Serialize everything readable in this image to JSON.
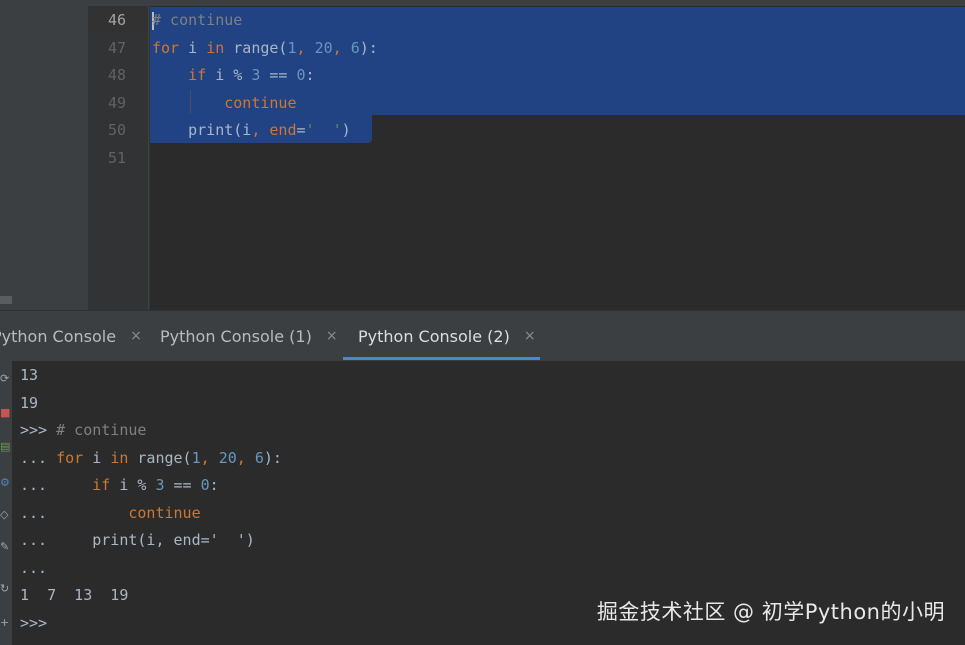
{
  "editor": {
    "line_numbers": [
      "46",
      "47",
      "48",
      "49",
      "50",
      "51"
    ],
    "lines": [
      {
        "parts": [
          {
            "t": "# continue",
            "c": "cm"
          }
        ]
      },
      {
        "parts": [
          {
            "t": "for",
            "c": "kw"
          },
          {
            "t": " i ",
            "c": ""
          },
          {
            "t": "in",
            "c": "kw"
          },
          {
            "t": " range(",
            "c": ""
          },
          {
            "t": "1",
            "c": "num"
          },
          {
            "t": ", ",
            "c": "kw"
          },
          {
            "t": "20",
            "c": "num"
          },
          {
            "t": ", ",
            "c": "kw"
          },
          {
            "t": "6",
            "c": "num"
          },
          {
            "t": "):",
            "c": ""
          }
        ]
      },
      {
        "parts": [
          {
            "t": "    ",
            "c": ""
          },
          {
            "t": "if",
            "c": "kw"
          },
          {
            "t": " i % ",
            "c": ""
          },
          {
            "t": "3",
            "c": "num"
          },
          {
            "t": " == ",
            "c": ""
          },
          {
            "t": "0",
            "c": "num"
          },
          {
            "t": ":",
            "c": ""
          }
        ]
      },
      {
        "parts": [
          {
            "t": "        ",
            "c": ""
          },
          {
            "t": "continue",
            "c": "kw"
          }
        ]
      },
      {
        "parts": [
          {
            "t": "    print(i",
            "c": ""
          },
          {
            "t": ", ",
            "c": "kw"
          },
          {
            "t": "end",
            "c": "kw"
          },
          {
            "t": "=",
            "c": ""
          },
          {
            "t": "'  '",
            "c": "str"
          },
          {
            "t": ")",
            "c": ""
          }
        ]
      },
      {
        "parts": []
      }
    ]
  },
  "tabs": [
    {
      "label": "Python Console",
      "close": "×",
      "active": false
    },
    {
      "label": "Python Console (1)",
      "close": "×",
      "active": false
    },
    {
      "label": "Python Console (2)",
      "close": "×",
      "active": true
    }
  ],
  "console": {
    "lines": [
      {
        "parts": [
          {
            "t": "13",
            "c": ""
          }
        ]
      },
      {
        "parts": [
          {
            "t": "19",
            "c": ""
          }
        ]
      },
      {
        "parts": [
          {
            "t": ">>> ",
            "c": ""
          },
          {
            "t": "# continue",
            "c": "cm"
          }
        ]
      },
      {
        "parts": [
          {
            "t": "... ",
            "c": ""
          },
          {
            "t": "for",
            "c": "kw"
          },
          {
            "t": " i ",
            "c": ""
          },
          {
            "t": "in",
            "c": "kw"
          },
          {
            "t": " range(",
            "c": ""
          },
          {
            "t": "1",
            "c": "num"
          },
          {
            "t": ", ",
            "c": "kw"
          },
          {
            "t": "20",
            "c": "num"
          },
          {
            "t": ", ",
            "c": "kw"
          },
          {
            "t": "6",
            "c": "num"
          },
          {
            "t": "):",
            "c": ""
          }
        ]
      },
      {
        "parts": [
          {
            "t": "...     ",
            "c": ""
          },
          {
            "t": "if",
            "c": "kw"
          },
          {
            "t": " i % ",
            "c": ""
          },
          {
            "t": "3",
            "c": "num"
          },
          {
            "t": " == ",
            "c": ""
          },
          {
            "t": "0",
            "c": "num"
          },
          {
            "t": ":",
            "c": ""
          }
        ]
      },
      {
        "parts": [
          {
            "t": "...         ",
            "c": ""
          },
          {
            "t": "continue",
            "c": "kw"
          }
        ]
      },
      {
        "parts": [
          {
            "t": "...     print(i, end='  ')",
            "c": ""
          }
        ]
      },
      {
        "parts": [
          {
            "t": "...",
            "c": ""
          }
        ]
      },
      {
        "parts": [
          {
            "t": "1  7  13  19",
            "c": ""
          }
        ]
      },
      {
        "parts": [
          {
            "t": ">>>",
            "c": ""
          }
        ]
      }
    ]
  },
  "watermark": "掘金技术社区 @ 初学Python的小明",
  "colors": {
    "selection": "#214283",
    "keyword": "#cc7832",
    "number": "#6897bb",
    "comment": "#808080",
    "string": "#6a8759",
    "tab_underline": "#4a88c7"
  },
  "icons": [
    "rerun-icon",
    "stop-icon",
    "console-icon",
    "settings-icon",
    "eye-icon",
    "edit-icon",
    "attach-icon",
    "add-icon"
  ]
}
